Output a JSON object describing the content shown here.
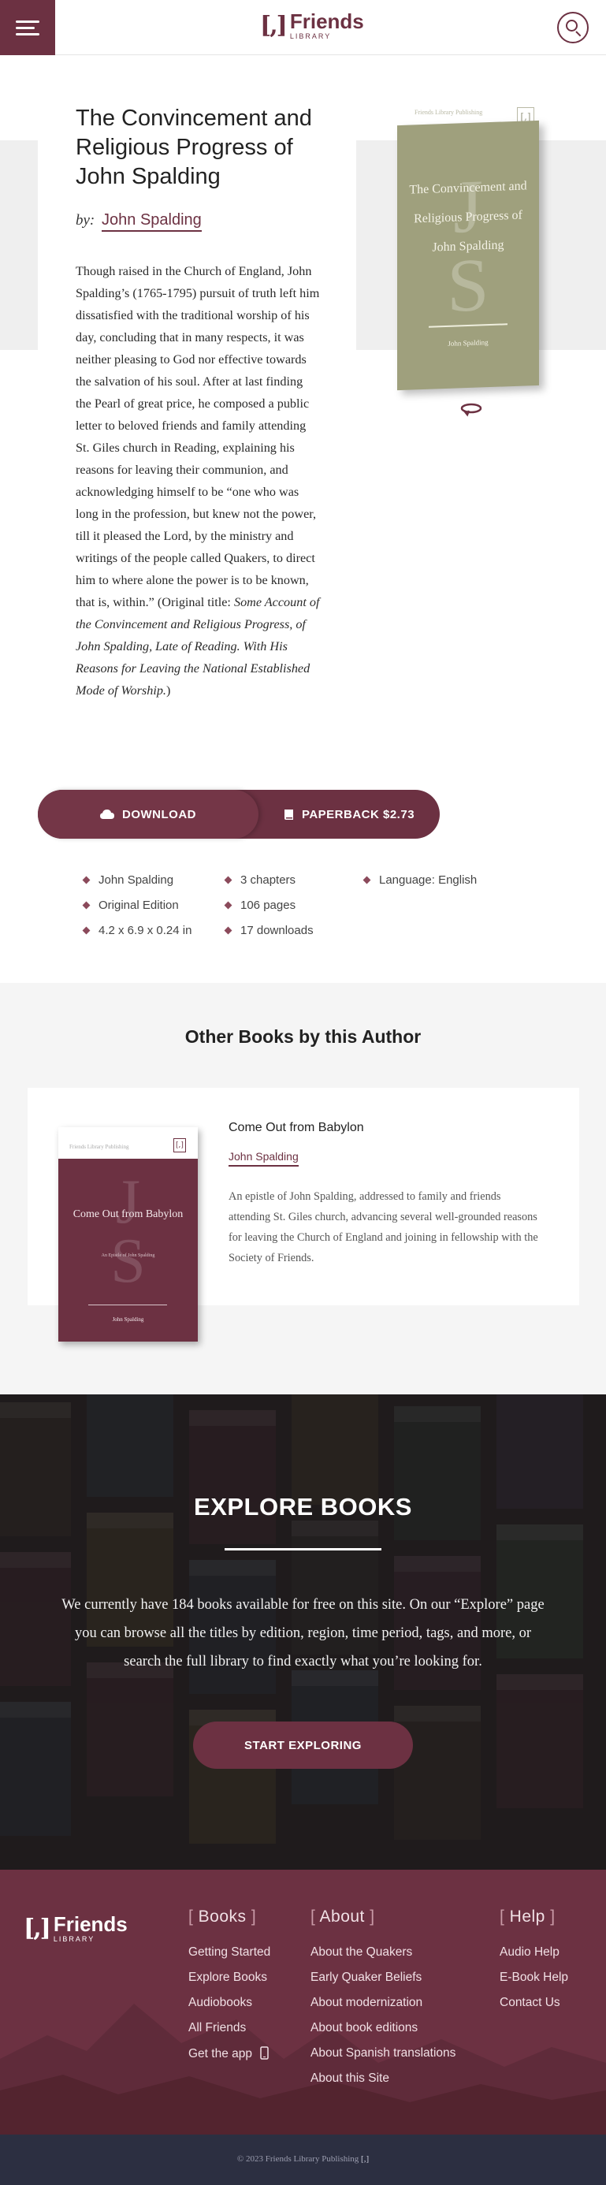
{
  "header": {
    "logo_mark": "[,]",
    "logo_name": "Friends",
    "logo_sub": "LIBRARY",
    "menu_icon": "hamburger-icon",
    "search_icon": "search-icon"
  },
  "book": {
    "title": "The Convincement and Religious Progress of John Spalding",
    "by_label": "by:",
    "author": "John Spalding",
    "description": "Though raised in the Church of England, John Spalding’s (1765-1795) pursuit of truth left him dissatisfied with the traditional worship of his day, concluding that in many respects, it was neither pleasing to God nor effective towards the salvation of his soul. After at last finding the Pearl of great price, he composed a public letter to beloved friends and family attending St. Giles church in Reading, explaining his reasons for leaving their communion, and acknowledging himself to be “one who was long in the profession, but knew not the power, till it pleased the Lord, by the ministry and writings of the people called Quakers, to direct him to where alone the power is to be known, that is, within.” (Original title: ",
    "original_title": "Some Account of the Convincement and Religious Progress, of John Spalding, Late of Reading. With His Reasons for Leaving the National Established Mode of Worship.",
    "description_end": ")",
    "cover": {
      "publisher": "Friends Library Publishing",
      "mark": "[,]",
      "title": "The Convincement and Religious Progress of John Spalding",
      "initial_j": "J",
      "initial_s": "S",
      "author": "John Spalding",
      "color": "#9fa07d"
    },
    "rotate_icon": "rotate-icon"
  },
  "actions": {
    "download_label": "DOWNLOAD",
    "download_icon": "cloud-download-icon",
    "paperback_label": "PAPERBACK $2.73",
    "paperback_icon": "book-icon"
  },
  "meta": {
    "author": "John Spalding",
    "edition": "Original Edition",
    "size": "4.2 x 6.9 x 0.24 in",
    "chapters": "3 chapters",
    "pages": "106 pages",
    "downloads": "17 downloads",
    "language": "Language: English"
  },
  "other_books": {
    "heading": "Other Books by this Author",
    "items": [
      {
        "title": "Come Out from Babylon",
        "author": "John Spalding",
        "description": "An epistle of John Spalding, addressed to family and friends attending St. Giles church, advancing several well-grounded reasons for leaving the Church of England and joining in fellowship with the Society of Friends.",
        "cover_title": "Come Out from Babylon",
        "cover_publisher": "Friends Library Publishing",
        "cover_mark": "[,]",
        "cover_subtitle": "An Epistle of John Spalding",
        "cover_author": "John Spalding",
        "cover_color": "#6c3142"
      }
    ]
  },
  "explore": {
    "title": "EXPLORE BOOKS",
    "text": "We currently have 184 books available for free on this site. On our “Explore” page you can browse all the titles by edition, region, time period, tags, and more, or search the full library to find exactly what you’re looking for.",
    "button": "START EXPLORING"
  },
  "footer": {
    "logo_mark": "[,]",
    "logo_name": "Friends",
    "logo_sub": "LIBRARY",
    "books": {
      "heading": "Books",
      "links": [
        "Getting Started",
        "Explore Books",
        "Audiobooks",
        "All Friends",
        "Get the app"
      ]
    },
    "about": {
      "heading": "About",
      "links": [
        "About the Quakers",
        "Early Quaker Beliefs",
        "About modernization",
        "About book editions",
        "About Spanish translations",
        "About this Site"
      ]
    },
    "help": {
      "heading": "Help",
      "links": [
        "Audio Help",
        "E-Book Help",
        "Contact Us"
      ]
    },
    "copyright": "© 2023 Friends Library Publishing",
    "copyright_mark": "[,]",
    "phone_icon": "phone-icon"
  },
  "colors": {
    "brand": "#6c3142",
    "footer_bottom": "#2c2f41",
    "explore_bg": "#262223"
  }
}
